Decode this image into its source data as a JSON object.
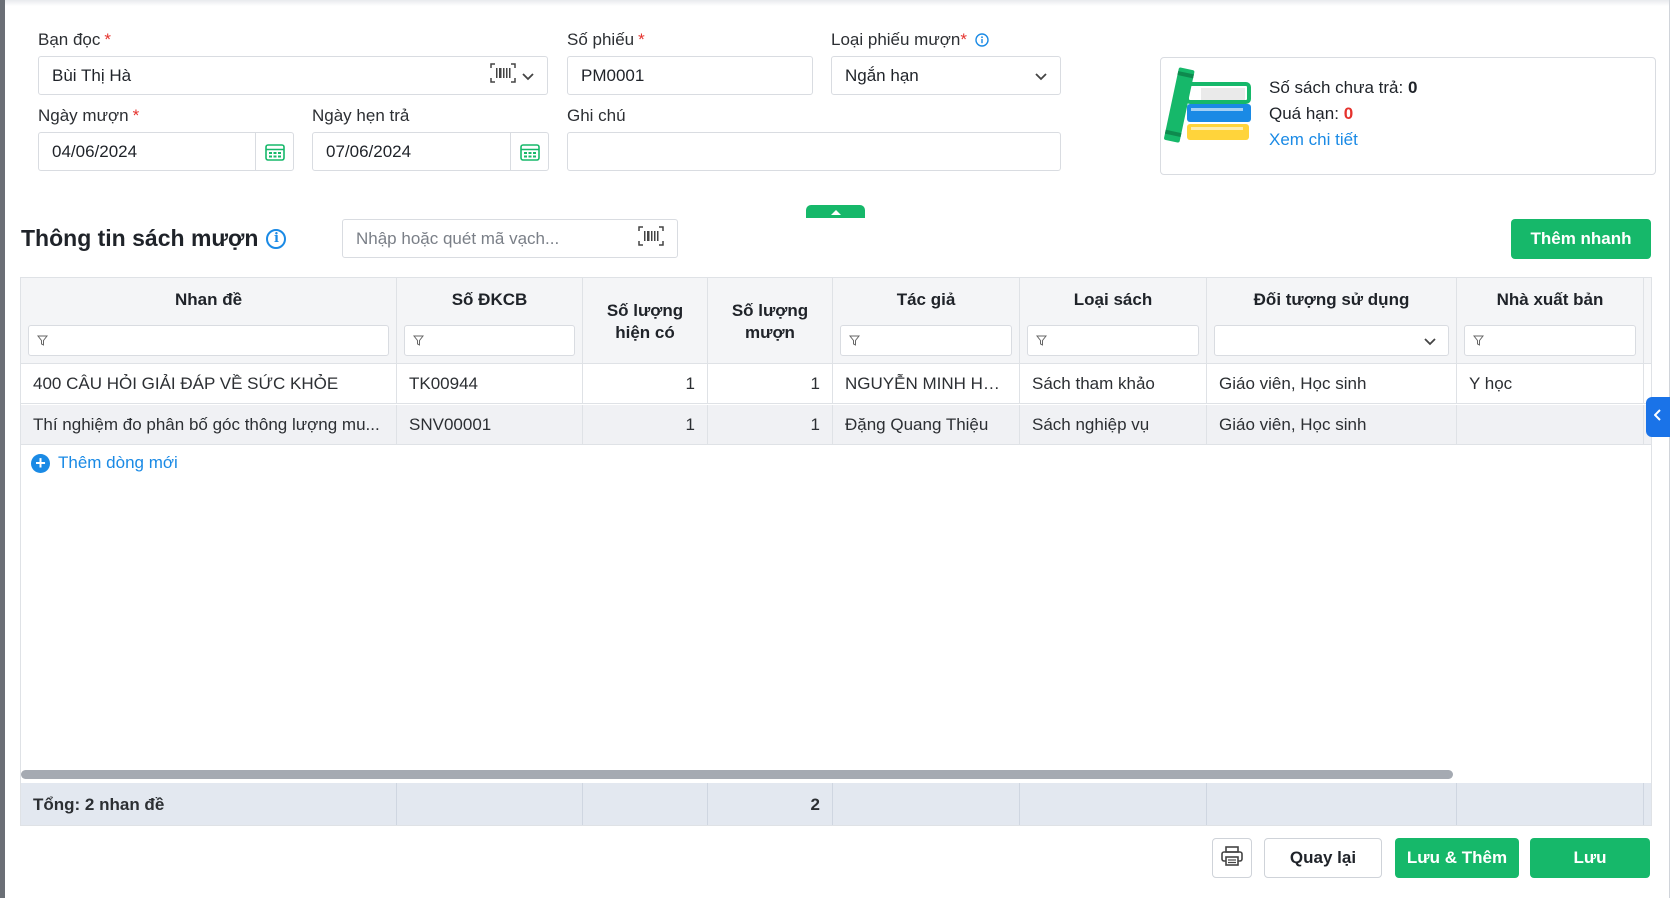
{
  "form": {
    "reader": {
      "label": "Bạn đọc",
      "required": "*",
      "value": "Bùi Thị Hà"
    },
    "ticket_no": {
      "label": "Số phiếu",
      "required": "*",
      "value": "PM0001"
    },
    "loan_type": {
      "label": "Loại phiếu mượn",
      "required": "*",
      "value": "Ngắn hạn"
    },
    "borrow_date": {
      "label": "Ngày mượn",
      "required": "*",
      "value": "04/06/2024"
    },
    "due_date": {
      "label": "Ngày hẹn trả",
      "value": "07/06/2024"
    },
    "note": {
      "label": "Ghi chú",
      "value": ""
    }
  },
  "summary": {
    "unreturned_label": "Số sách chưa trả:",
    "unreturned_value": "0",
    "overdue_label": "Quá hạn:",
    "overdue_value": "0",
    "detail_link": "Xem chi tiết"
  },
  "books": {
    "title": "Thông tin sách mượn",
    "info_glyph": "i",
    "search_placeholder": "Nhập hoặc quét mã vạch...",
    "quick_add_label": "Thêm nhanh",
    "columns": {
      "title": "Nhan đề",
      "reg_no": "Số ĐKCB",
      "qty_available_1": "Số lượng",
      "qty_available_2": "hiện có",
      "qty_borrow_1": "Số lượng",
      "qty_borrow_2": "mượn",
      "author": "Tác giả",
      "book_type": "Loại sách",
      "audience": "Đối tượng sử dụng",
      "publisher": "Nhà xuất bản"
    },
    "rows": [
      {
        "title": "400 CÂU HỎI GIẢI ĐÁP VỀ SỨC KHỎE",
        "reg_no": "TK00944",
        "qty_available": "1",
        "qty_borrow": "1",
        "author": "NGUYỄN MINH HỒ...",
        "book_type": "Sách tham khảo",
        "audience": "Giáo viên, Học sinh",
        "publisher": "Y học"
      },
      {
        "title": "Thí nghiệm đo phân bố góc thông lượng mu...",
        "reg_no": "SNV00001",
        "qty_available": "1",
        "qty_borrow": "1",
        "author": "Đặng Quang Thiệu",
        "book_type": "Sách nghiệp vụ",
        "audience": "Giáo viên, Học sinh",
        "publisher": ""
      }
    ],
    "add_row_label": "Thêm dòng mới",
    "total_label": "Tổng: 2 nhan đề",
    "total_borrow": "2"
  },
  "actions": {
    "back_label": "Quay lại",
    "save_add_label": "Lưu & Thêm",
    "save_label": "Lưu"
  },
  "colors": {
    "accent_green": "#16b86a",
    "link_blue": "#1a8ae5",
    "required_red": "#e5322d"
  },
  "icons": [
    "barcode-icon",
    "chevron-down-icon",
    "info-icon",
    "calendar-icon",
    "filter-icon",
    "add-circle-icon",
    "printer-icon",
    "chevron-up-icon",
    "chevron-left-icon",
    "books-illustration"
  ]
}
